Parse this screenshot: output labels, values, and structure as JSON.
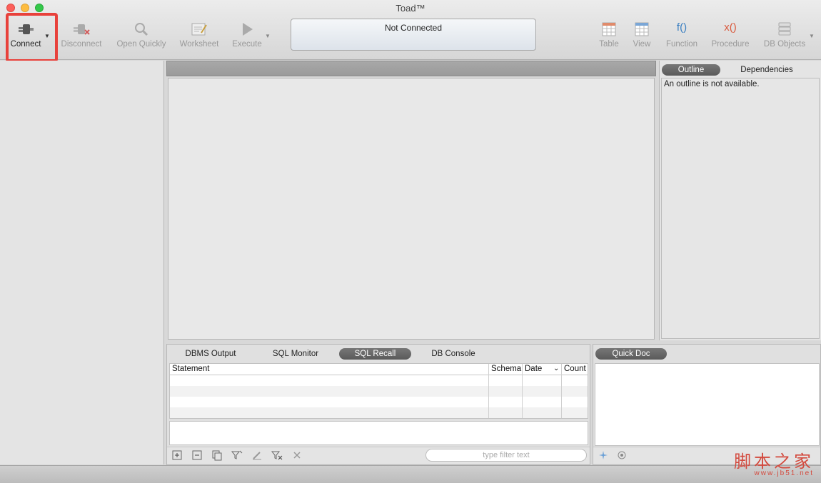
{
  "window": {
    "title": "Toad™"
  },
  "toolbar": {
    "connect": "Connect",
    "disconnect": "Disconnect",
    "open_quickly": "Open Quickly",
    "worksheet": "Worksheet",
    "execute": "Execute",
    "table": "Table",
    "view": "View",
    "function": "Function",
    "procedure": "Procedure",
    "db_objects": "DB Objects",
    "function_glyph": "f()",
    "procedure_glyph": "x()"
  },
  "connection": {
    "status": "Not Connected"
  },
  "right_panel": {
    "tabs": [
      "Outline",
      "Dependencies"
    ],
    "active_tab": "Outline",
    "message": "An outline is not available."
  },
  "bottom_panel": {
    "tabs": [
      "DBMS Output",
      "SQL Monitor",
      "SQL Recall",
      "DB Console"
    ],
    "active_tab": "SQL Recall",
    "columns": [
      "Statement",
      "Schema",
      "Date",
      "Count"
    ],
    "filter_placeholder": "type filter text"
  },
  "quick_doc": {
    "tab": "Quick Doc"
  },
  "watermark": {
    "cn": "脚本之家",
    "url": "www.jb51.net"
  },
  "colors": {
    "highlight": "#e8413b",
    "function": "#3a7fc1",
    "procedure": "#d9583b"
  }
}
